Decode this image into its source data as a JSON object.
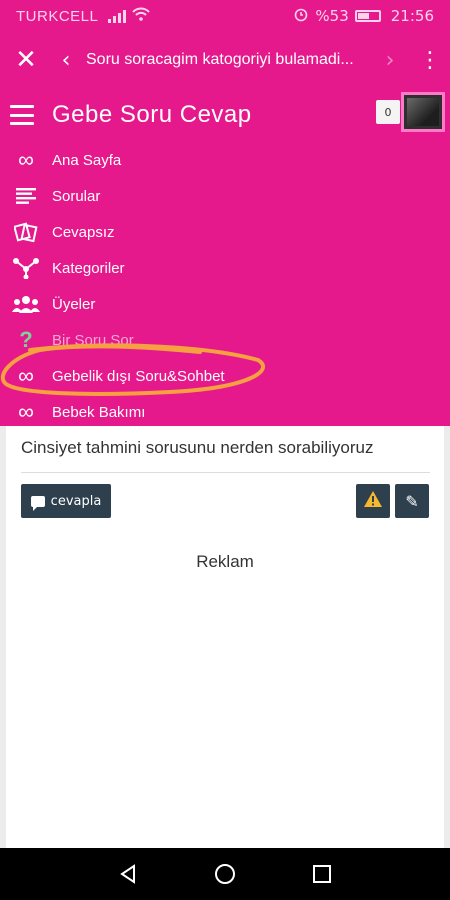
{
  "status": {
    "carrier": "TURKCELL",
    "battery": "%53",
    "time": "21:56",
    "battery_level": 0.53
  },
  "appbar": {
    "title": "Soru soracagim katogoriyi bulamadi..."
  },
  "drawer": {
    "brand": "Gebe Soru Cevap",
    "notification_count": "0",
    "items": [
      {
        "label": "Ana Sayfa",
        "icon": "infinity-icon"
      },
      {
        "label": "Sorular",
        "icon": "list-icon"
      },
      {
        "label": "Cevapsız",
        "icon": "cards-icon"
      },
      {
        "label": "Kategoriler",
        "icon": "share-tree-icon"
      },
      {
        "label": "Üyeler",
        "icon": "users-icon"
      },
      {
        "label": "Bir Soru Sor",
        "icon": "question-icon"
      },
      {
        "label": "Gebelik dışı Soru&Sohbet",
        "icon": "infinity-icon"
      },
      {
        "label": "Bebek Bakımı",
        "icon": "infinity-icon"
      }
    ]
  },
  "content": {
    "question": "Cinsiyet tahmini sorusunu nerden sorabiliyoruz",
    "answer_label": "cevapla",
    "ad_label": "Reklam"
  },
  "colors": {
    "brand": "#e5198c",
    "dark_button": "#2e3f4e",
    "highlight": "#f5a041",
    "warning": "#f5b82e"
  }
}
